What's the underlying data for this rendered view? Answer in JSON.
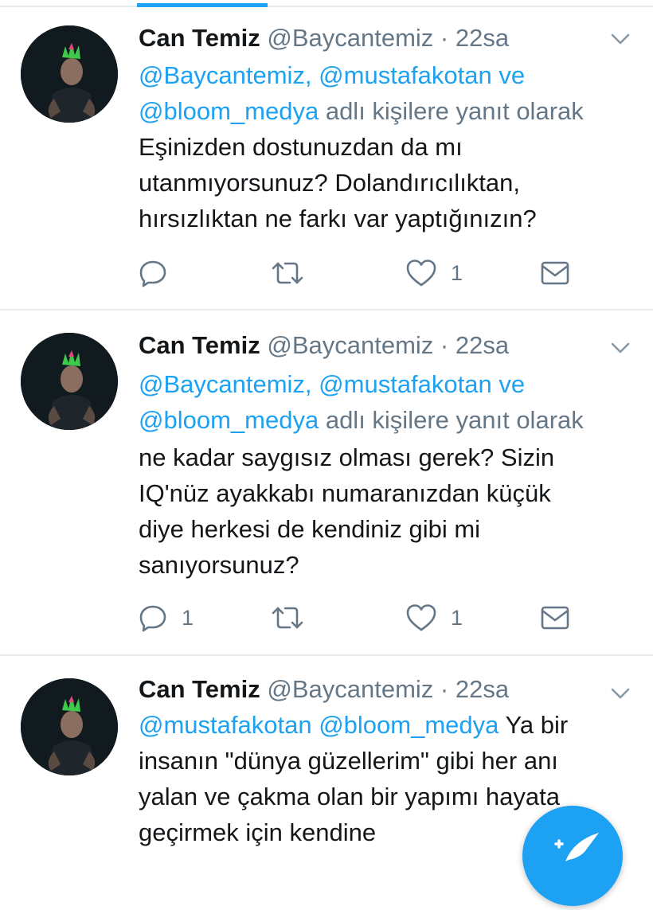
{
  "tweets": [
    {
      "name": "Can Temiz",
      "handle": "@Baycantemiz",
      "dot": "·",
      "time": "22sa",
      "reply_mentions": [
        "@Baycantemiz,",
        "@mustafakotan",
        "ve",
        "@bloom_medya",
        "adlı kişilere yanıt olarak"
      ],
      "text_lines": [
        "Eşinizden dostunuzdan da mı",
        "utanmıyorsunuz? Dolandırıcılıktan,",
        "hırsızlıktan ne farkı var yaptığınızın?"
      ],
      "replies": "",
      "retweets": "",
      "likes": "1"
    },
    {
      "name": "Can Temiz",
      "handle": "@Baycantemiz",
      "dot": "·",
      "time": "22sa",
      "reply_mentions": [
        "@Baycantemiz,",
        "@mustafakotan",
        "ve",
        "@bloom_medya",
        "adlı kişilere yanıt olarak"
      ],
      "text_lines": [
        "ne kadar saygısız olması gerek? Sizin",
        "IQ'nüz ayakkabı numaranızdan küçük",
        "diye herkesi de kendiniz gibi mi",
        "sanıyorsunuz?"
      ],
      "replies": "1",
      "retweets": "",
      "likes": "1"
    },
    {
      "name": "Can Temiz",
      "handle": "@Baycantemiz",
      "dot": "·",
      "time": "22sa",
      "line1_mentions": [
        "@mustafakotan",
        "@bloom_medya"
      ],
      "line1_text": "Ya bir",
      "text_lines": [
        "insanın \"dünya güzellerim\" gibi her anı",
        "yalan ve çakma olan bir yapımı hayata",
        "geçirmek için kendine"
      ]
    }
  ],
  "colors": {
    "accent": "#1da1f2",
    "secondary_text": "#657786",
    "divider": "#e6ecf0"
  },
  "icons": [
    "reply-icon",
    "retweet-icon",
    "like-icon",
    "dm-icon",
    "chevron-down-icon",
    "compose-tweet-icon"
  ]
}
